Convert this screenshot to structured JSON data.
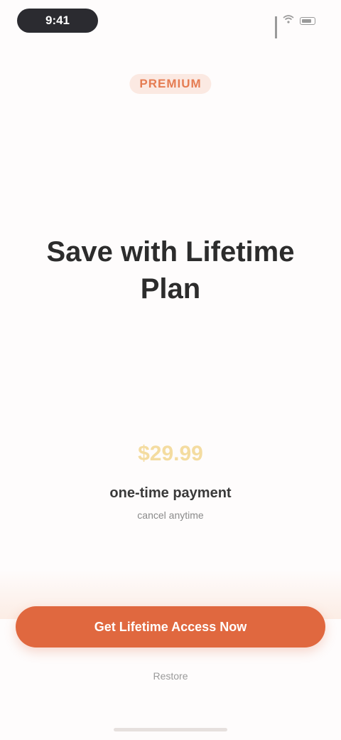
{
  "status_bar": {
    "time": "9:41",
    "icons": [
      "signal-icon",
      "wifi-icon",
      "battery-icon"
    ]
  },
  "brand": {
    "label": "PREMIUM"
  },
  "hero": {
    "title": "Save with Lifetime Plan"
  },
  "pricing": {
    "amount": "$29.99",
    "period": "one-time payment",
    "note": "cancel anytime"
  },
  "cta": {
    "label": "Get Lifetime Access Now"
  },
  "secondary": {
    "label": "Restore"
  },
  "colors": {
    "accent": "#e0683f",
    "brand_text": "#e57c52",
    "brand_bg": "#fbe9e2",
    "price": "#f4dca0",
    "background": "#fefcfc"
  }
}
